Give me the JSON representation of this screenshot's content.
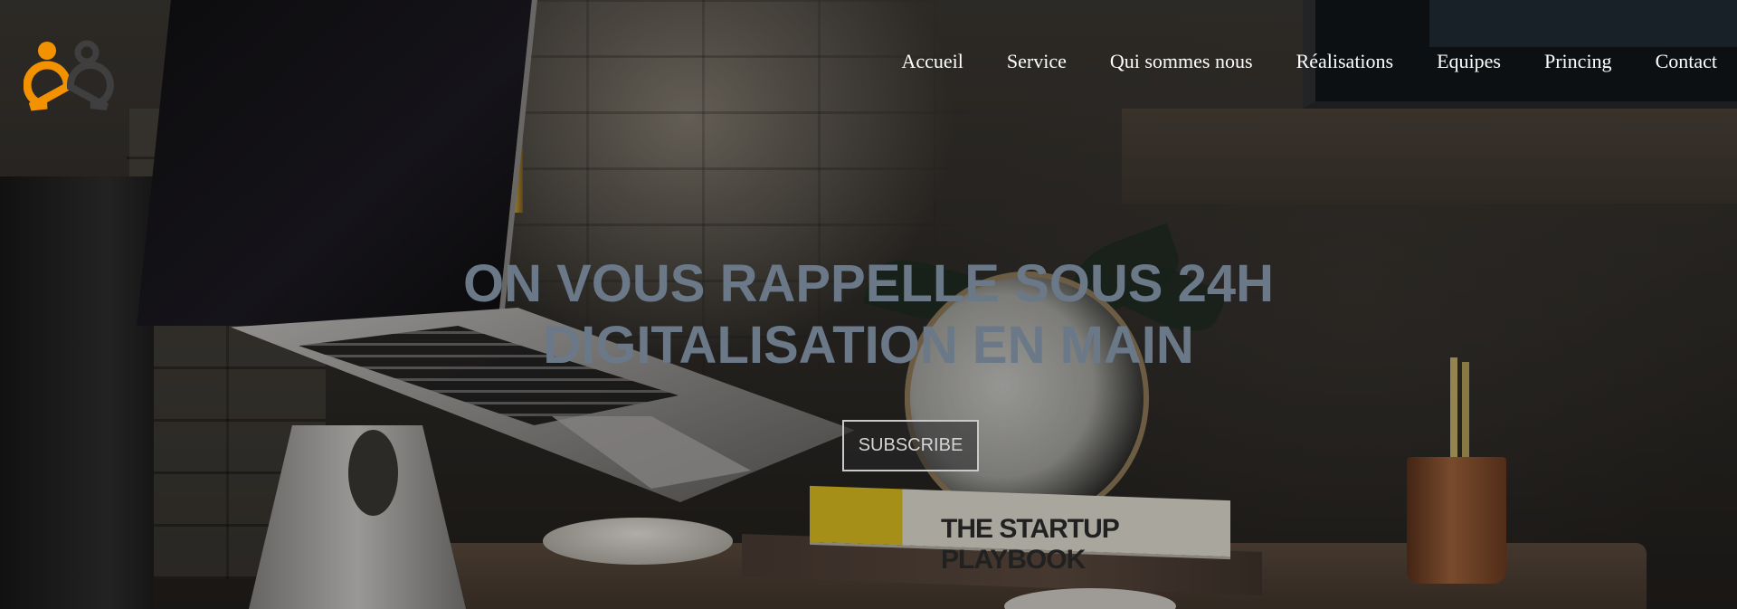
{
  "brand": {
    "logo_icon": "people-chat-icon",
    "colors": {
      "orange": "#F39200",
      "dark": "#3F3F3F"
    }
  },
  "nav": {
    "items": [
      {
        "label": "Accueil"
      },
      {
        "label": "Service"
      },
      {
        "label": "Qui sommes nous"
      },
      {
        "label": "Réalisations"
      },
      {
        "label": "Equipes"
      },
      {
        "label": "Princing"
      },
      {
        "label": "Contact"
      }
    ]
  },
  "hero": {
    "headline_line1": "ON VOUS RAPPELLE SOUS 24H",
    "headline_line2": "DIGITALISATION EN MAIN",
    "headline_color": "#6A7887",
    "subscribe_label": "SUBSCRIBE",
    "background_scene": {
      "book_title": "THE STARTUP PLAYBOOK"
    }
  }
}
